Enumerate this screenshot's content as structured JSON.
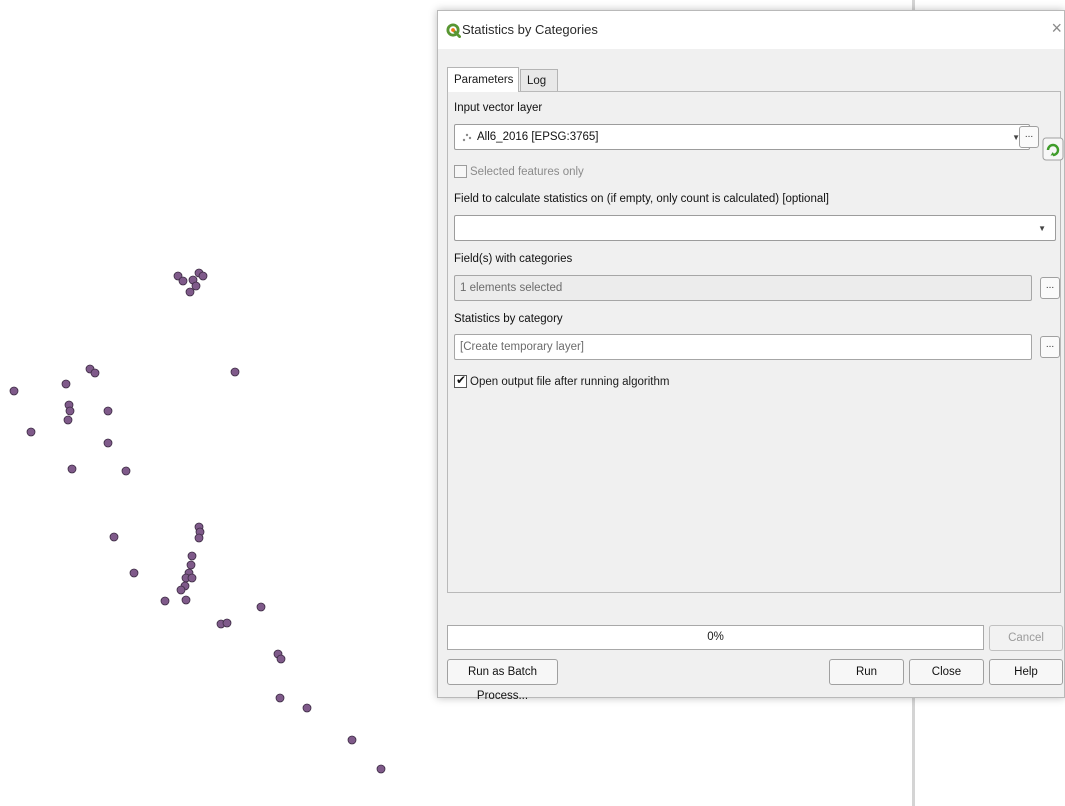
{
  "dialog": {
    "title": "Statistics by Categories",
    "close_glyph": "×",
    "tabs": [
      "Parameters",
      "Log"
    ],
    "active_tab": "Parameters"
  },
  "params": {
    "input_layer_label": "Input vector layer",
    "input_layer_value": "All6_2016 [EPSG:3765]",
    "selected_only_label": "Selected features only",
    "selected_only_checked": false,
    "stats_field_label": "Field to calculate statistics on (if empty, only count is calculated) [optional]",
    "stats_field_value": "",
    "categories_label": "Field(s) with categories",
    "categories_value": "1 elements selected",
    "output_label": "Statistics by category",
    "output_placeholder": "[Create temporary layer]",
    "open_output_label": "Open output file after running algorithm",
    "open_output_checked": true,
    "browse_glyph": "..."
  },
  "footer": {
    "progress_text": "0%",
    "progress_value": 0,
    "cancel_label": "Cancel",
    "batch_label": "Run as Batch Process...",
    "run_label": "Run",
    "close_label": "Close",
    "help_label": "Help"
  },
  "colors": {
    "point_fill": "#7f5a8a",
    "point_stroke": "#3b2a42"
  },
  "icons": {
    "app": "qgis-logo-icon",
    "layer": "point-layer-icon",
    "iterate": "iterate-icon"
  }
}
